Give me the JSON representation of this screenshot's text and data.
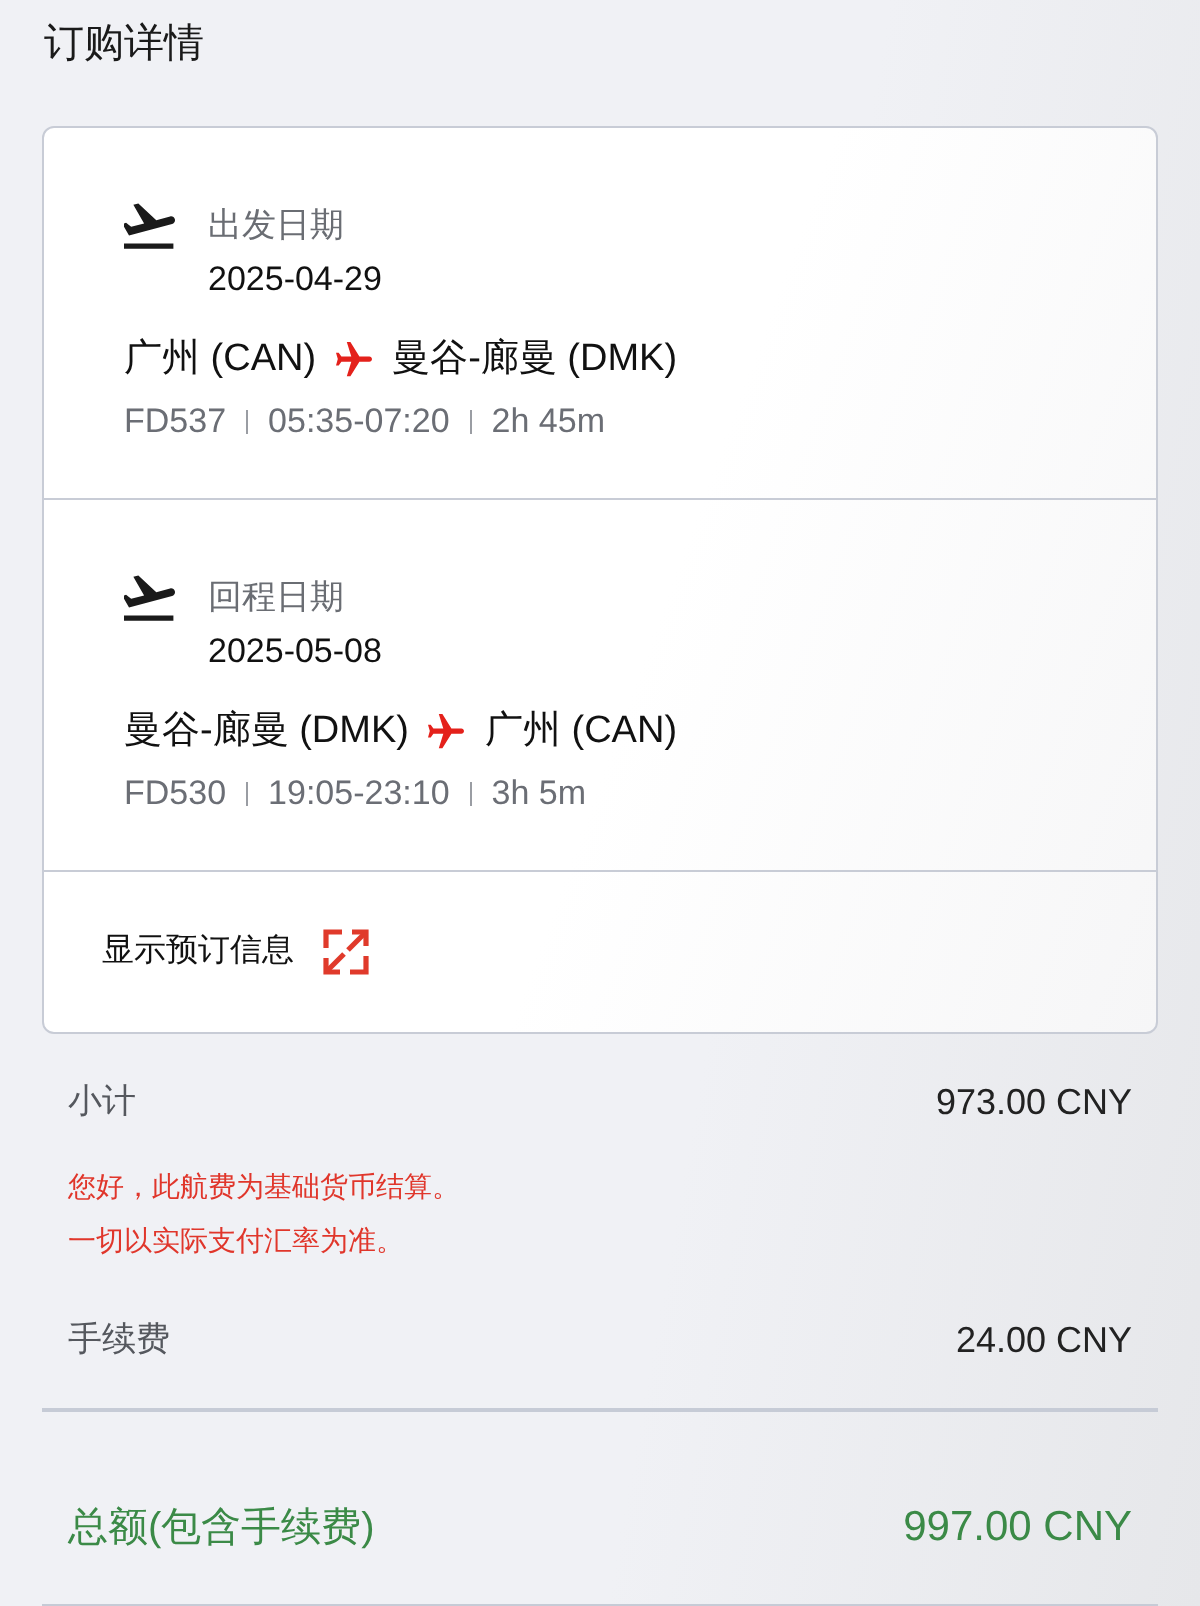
{
  "page": {
    "title": "订购详情"
  },
  "flights": [
    {
      "date_label": "出发日期",
      "date": "2025-04-29",
      "origin": "广州 (CAN)",
      "destination": "曼谷-廊曼 (DMK)",
      "flight_no": "FD537",
      "times": "05:35-07:20",
      "duration": "2h 45m"
    },
    {
      "date_label": "回程日期",
      "date": "2025-05-08",
      "origin": "曼谷-廊曼 (DMK)",
      "destination": "广州 (CAN)",
      "flight_no": "FD530",
      "times": "19:05-23:10",
      "duration": "3h 5m"
    }
  ],
  "booking_link": {
    "label": "显示预订信息"
  },
  "price": {
    "subtotal": {
      "label": "小计",
      "value": "973.00 CNY"
    },
    "notice": [
      "您好，此航费为基础货币结算。",
      "一切以实际支付汇率为准。"
    ],
    "fee": {
      "label": "手续费",
      "value": "24.00 CNY"
    },
    "total": {
      "label": "总额(包含手续费)",
      "value": "997.00 CNY"
    }
  }
}
